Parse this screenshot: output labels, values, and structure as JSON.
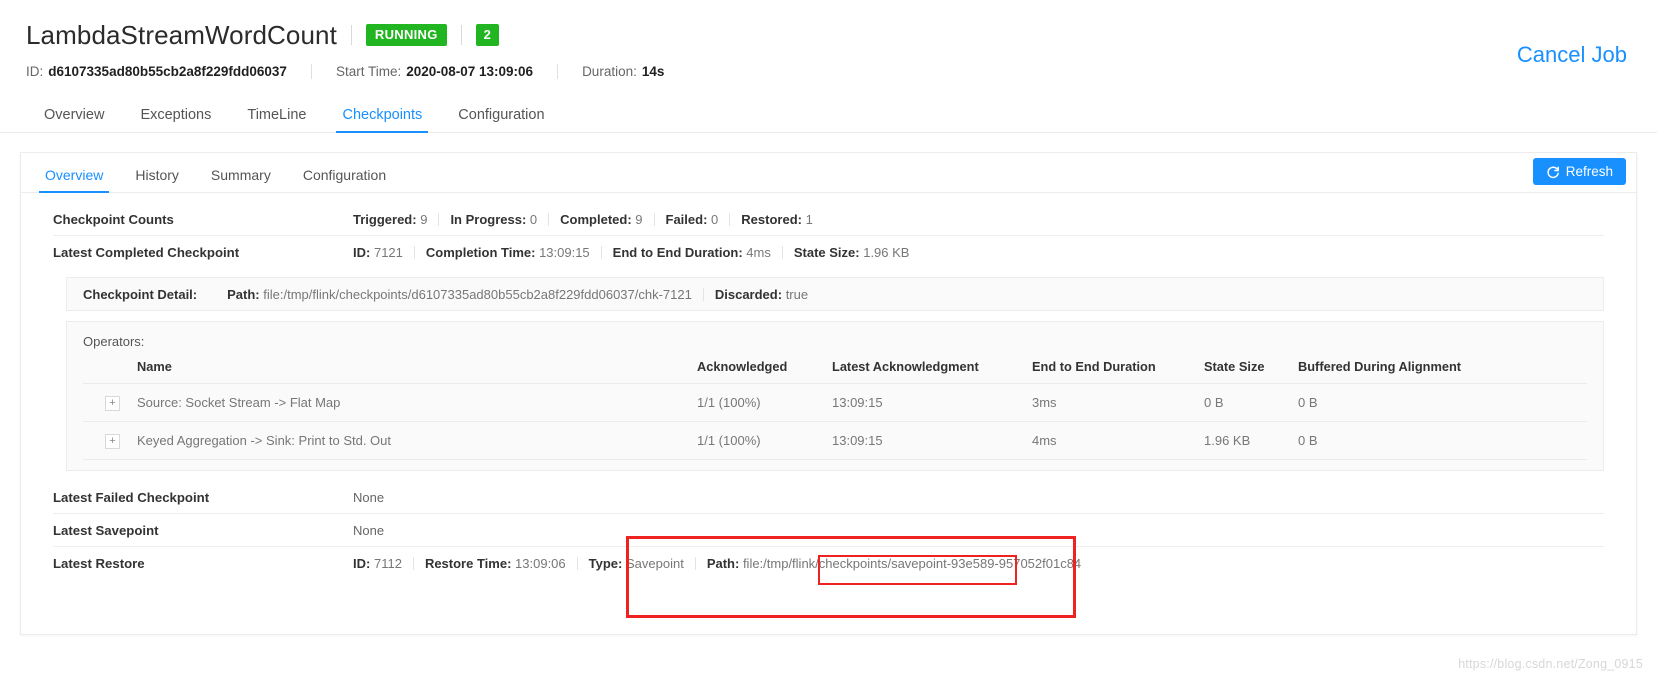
{
  "job": {
    "title": "LambdaStreamWordCount",
    "status_badge": "RUNNING",
    "parallelism_badge": "2",
    "id_label": "ID:",
    "id_value": "d6107335ad80b55cb2a8f229fdd06037",
    "start_time_label": "Start Time:",
    "start_time_value": "2020-08-07 13:09:06",
    "duration_label": "Duration:",
    "duration_value": "14s",
    "cancel_job": "Cancel Job"
  },
  "main_tabs": [
    {
      "label": "Overview",
      "active": false
    },
    {
      "label": "Exceptions",
      "active": false
    },
    {
      "label": "TimeLine",
      "active": false
    },
    {
      "label": "Checkpoints",
      "active": true
    },
    {
      "label": "Configuration",
      "active": false
    }
  ],
  "sub_tabs": [
    {
      "label": "Overview",
      "active": true
    },
    {
      "label": "History",
      "active": false
    },
    {
      "label": "Summary",
      "active": false
    },
    {
      "label": "Configuration",
      "active": false
    }
  ],
  "refresh_button": "Refresh",
  "checkpoint_counts": {
    "label": "Checkpoint Counts",
    "triggered_label": "Triggered:",
    "triggered_value": "9",
    "in_progress_label": "In Progress:",
    "in_progress_value": "0",
    "completed_label": "Completed:",
    "completed_value": "9",
    "failed_label": "Failed:",
    "failed_value": "0",
    "restored_label": "Restored:",
    "restored_value": "1"
  },
  "latest_completed": {
    "label": "Latest Completed Checkpoint",
    "id_label": "ID:",
    "id_value": "7121",
    "completion_time_label": "Completion Time:",
    "completion_time_value": "13:09:15",
    "e2e_label": "End to End Duration:",
    "e2e_value": "4ms",
    "state_size_label": "State Size:",
    "state_size_value": "1.96 KB"
  },
  "checkpoint_detail": {
    "label": "Checkpoint Detail:",
    "path_label": "Path:",
    "path_value": "file:/tmp/flink/checkpoints/d6107335ad80b55cb2a8f229fdd06037/chk-7121",
    "discarded_label": "Discarded:",
    "discarded_value": "true"
  },
  "operators": {
    "title": "Operators:",
    "columns": [
      "Name",
      "Acknowledged",
      "Latest Acknowledgment",
      "End to End Duration",
      "State Size",
      "Buffered During Alignment"
    ],
    "expander_glyph": "+",
    "rows": [
      {
        "name": "Source: Socket Stream -> Flat Map",
        "acknowledged": "1/1 (100%)",
        "latest_acknowledgment": "13:09:15",
        "end_to_end_duration": "3ms",
        "state_size": "0 B",
        "buffered_during_alignment": "0 B"
      },
      {
        "name": "Keyed Aggregation -> Sink: Print to Std. Out",
        "acknowledged": "1/1 (100%)",
        "latest_acknowledgment": "13:09:15",
        "end_to_end_duration": "4ms",
        "state_size": "1.96 KB",
        "buffered_during_alignment": "0 B"
      }
    ]
  },
  "latest_failed": {
    "label": "Latest Failed Checkpoint",
    "value": "None"
  },
  "latest_savepoint": {
    "label": "Latest Savepoint",
    "value": "None"
  },
  "latest_restore": {
    "label": "Latest Restore",
    "id_label": "ID:",
    "id_value": "7112",
    "restore_time_label": "Restore Time:",
    "restore_time_value": "13:09:06",
    "type_label": "Type:",
    "type_value": "Savepoint",
    "path_label": "Path:",
    "path_prefix": "file:/tmp/flink/checkpoints/",
    "path_highlight": "savepoint-93e589-957052f01c84"
  },
  "watermark": "https://blog.csdn.net/Zong_0915",
  "colors": {
    "accent": "#1890ff",
    "running_green": "#21b521",
    "annotation_red": "#ef2222"
  }
}
